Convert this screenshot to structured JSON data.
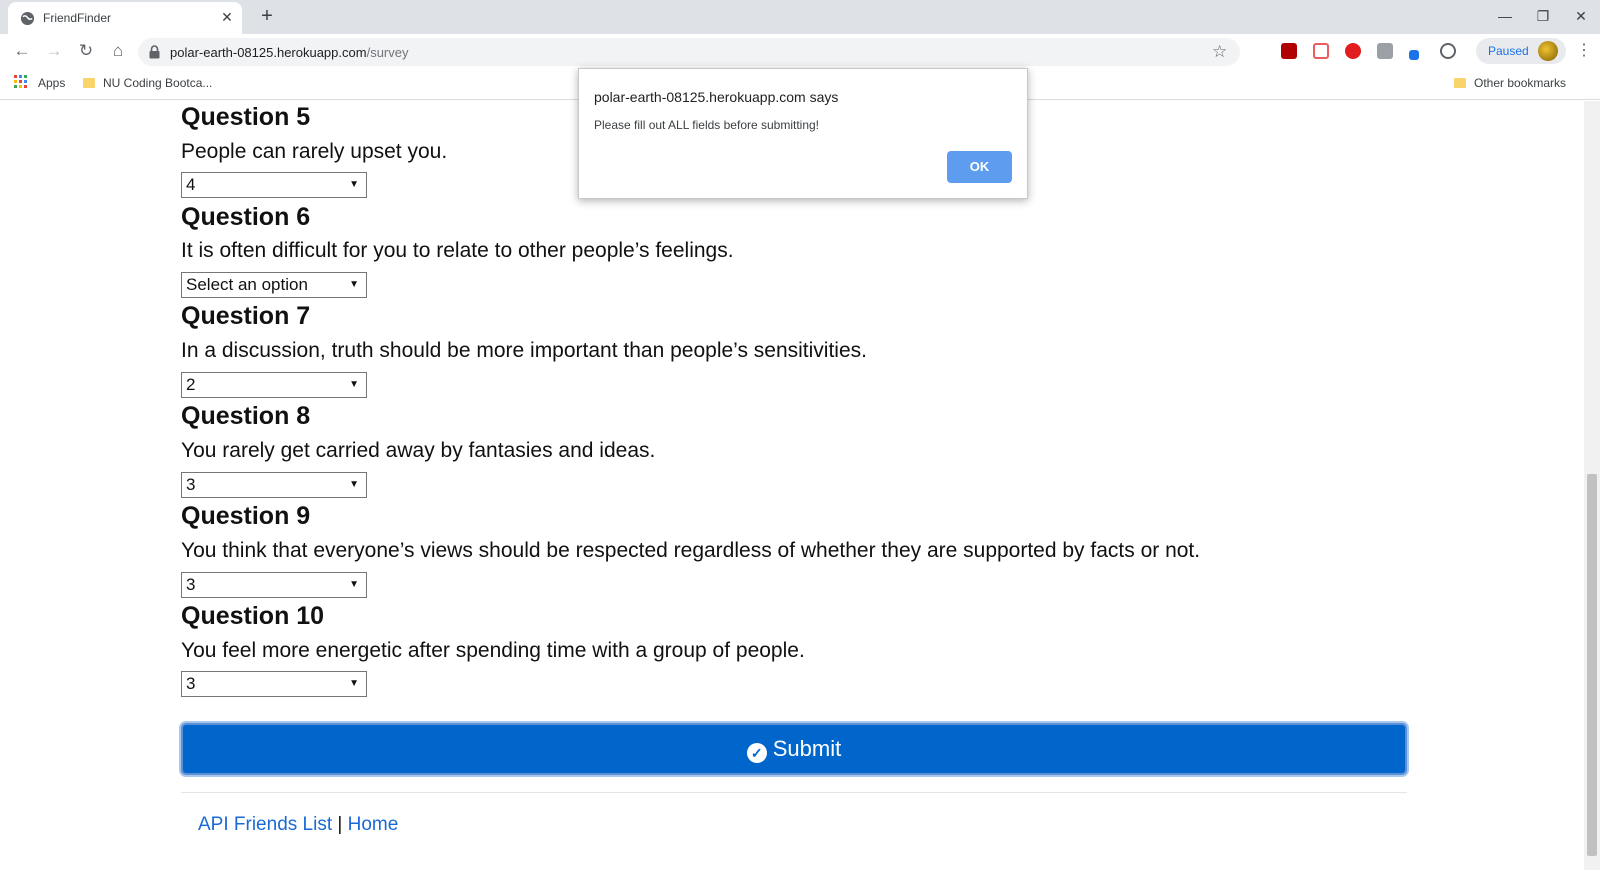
{
  "browser": {
    "tab_title": "FriendFinder",
    "url_host": "polar-earth-08125.herokuapp.com",
    "url_path": "/survey",
    "profile_status": "Paused",
    "bookmarks": {
      "apps": "Apps",
      "nu": "NU Coding Bootca...",
      "other": "Other bookmarks"
    }
  },
  "questions": [
    {
      "title": "Question 5",
      "text": "People can rarely upset you.",
      "selected": "4"
    },
    {
      "title": "Question 6",
      "text": "It is often difficult for you to relate to other people’s feelings.",
      "selected": "Select an option"
    },
    {
      "title": "Question 7",
      "text": "In a discussion, truth should be more important than people’s sensitivities.",
      "selected": "2"
    },
    {
      "title": "Question 8",
      "text": "You rarely get carried away by fantasies and ideas.",
      "selected": "3"
    },
    {
      "title": "Question 9",
      "text": "You think that everyone’s views should be respected regardless of whether they are supported by facts or not.",
      "selected": "3"
    },
    {
      "title": "Question 10",
      "text": "You feel more energetic after spending time with a group of people.",
      "selected": "3"
    }
  ],
  "submit_label": "Submit",
  "footer": {
    "api_link": "API Friends List",
    "separator": "|",
    "home_link": "Home"
  },
  "dialog": {
    "title": "polar-earth-08125.herokuapp.com says",
    "message": "Please fill out ALL fields before submitting!",
    "ok_label": "OK"
  },
  "colors": {
    "submit_bg": "#0066cc",
    "link": "#1a6ad6",
    "dialog_ok": "#1a73e8"
  }
}
